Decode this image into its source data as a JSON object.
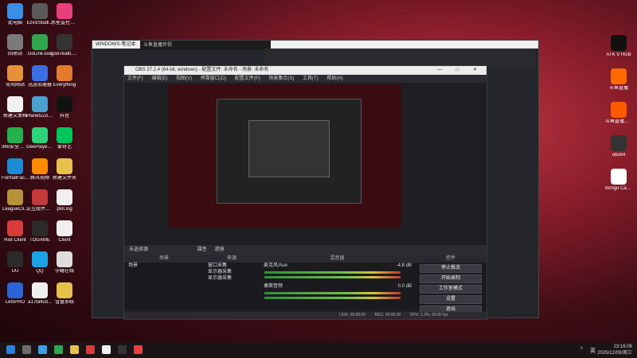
{
  "desktop_icons": [
    {
      "label": "此电脑",
      "color": "#3a8ee6"
    },
    {
      "label": "EzvizStudi...",
      "color": "#5a5a5a"
    },
    {
      "label": "水星监控系统",
      "color": "#e7407d"
    },
    {
      "label": "回收站",
      "color": "#7a7a7a"
    },
    {
      "label": "GoLink.exe",
      "color": "#2ea84f"
    },
    {
      "label": "god-realti...快捷方式",
      "color": "#333"
    },
    {
      "label": "常用网站",
      "color": "#e6903a"
    },
    {
      "label": "迅游加速器",
      "color": "#3a6fe6"
    },
    {
      "label": "Everything",
      "color": "#e47a2e"
    },
    {
      "label": "新建文本档",
      "color": "#f0f0f0"
    },
    {
      "label": "Planet2Zo...- 快捷方式",
      "color": "#4aa1d0"
    },
    {
      "label": "抖音",
      "color": "#111"
    },
    {
      "label": "360安全浏览器",
      "color": "#23b14d"
    },
    {
      "label": "GeePlayer.exe",
      "color": "#2bd37a"
    },
    {
      "label": "爱奇艺",
      "color": "#00c55a"
    },
    {
      "label": "FormatFac...",
      "color": "#1c8bd6"
    },
    {
      "label": "腾讯视频",
      "color": "#ff8a00"
    },
    {
      "label": "新建文件夹",
      "color": "#e6c04c"
    },
    {
      "label": "LeagueCli...",
      "color": "#b8923a"
    },
    {
      "label": "交互组件Online",
      "color": "#c43939"
    },
    {
      "label": "plot.log",
      "color": "#f0f0f0"
    },
    {
      "label": "Riot Client",
      "color": "#d93b3b"
    },
    {
      "label": "TOGAME",
      "color": "#2a2a2a"
    },
    {
      "label": "Client",
      "color": "#f0f0f0"
    },
    {
      "label": "UU",
      "color": "#2b2b2b"
    },
    {
      "label": "QQ",
      "color": "#1aa1e6"
    },
    {
      "label": "学籍在线",
      "color": "#ddd"
    },
    {
      "label": "LetsPRO",
      "color": "#2a64d6"
    },
    {
      "label": "a17ta4cd...",
      "color": "#f0f0f0"
    },
    {
      "label": "雪盘系统",
      "color": "#e6c04c"
    }
  ],
  "right_icons": [
    {
      "label": "ATK V HUB",
      "color": "#111"
    },
    {
      "label": "斗鱼直播",
      "color": "#ff6a00"
    },
    {
      "label": "斗鱼直播伴侣",
      "color": "#ff5a00"
    },
    {
      "label": "obs64",
      "color": "#333"
    },
    {
      "label": "Bongo Cat Mver...",
      "color": "#ffffff"
    }
  ],
  "obs": {
    "title": "OBS 27.2.4 (64-bit, windows) - 配置文件: 未命名 - 场景: 未命名",
    "menu": [
      "文件(F)",
      "编辑(E)",
      "视图(V)",
      "停靠窗口(D)",
      "配置文件(P)",
      "场景集合(S)",
      "工具(T)",
      "帮助(H)"
    ],
    "source_bar": [
      "未选择源",
      "属性",
      "滤镜"
    ],
    "docks": {
      "scenes": {
        "title": "场景",
        "items": [
          "场景"
        ]
      },
      "sources": {
        "title": "来源",
        "items": [
          "窗口采集",
          "显示器采集",
          "显示器采集"
        ]
      },
      "mixer": {
        "title": "混音器",
        "tracks": [
          {
            "name": "麦克风/Aux",
            "db": "-4.8 dB"
          },
          {
            "name": "桌面音频",
            "db": "0.0 dB"
          }
        ]
      },
      "transitions": {
        "title": "场景过渡"
      },
      "controls": {
        "title": "控件",
        "buttons": [
          "停止推流",
          "开始录制",
          "工作室模式",
          "设置",
          "退出"
        ]
      }
    },
    "status": {
      "live": "LIVE: 00:00:00",
      "rec": "REC: 00:00:00",
      "cpu": "CPU: 1.2%, 60.00 fps"
    }
  },
  "bg_windows": {
    "notepad": "WINDOWS-笔记本",
    "browser_tab": "斗鱼直播伴侣"
  },
  "taskbar": {
    "time": "23:16:06",
    "date": "2025/12/09/周三",
    "lang": "英",
    "tray": "^"
  }
}
